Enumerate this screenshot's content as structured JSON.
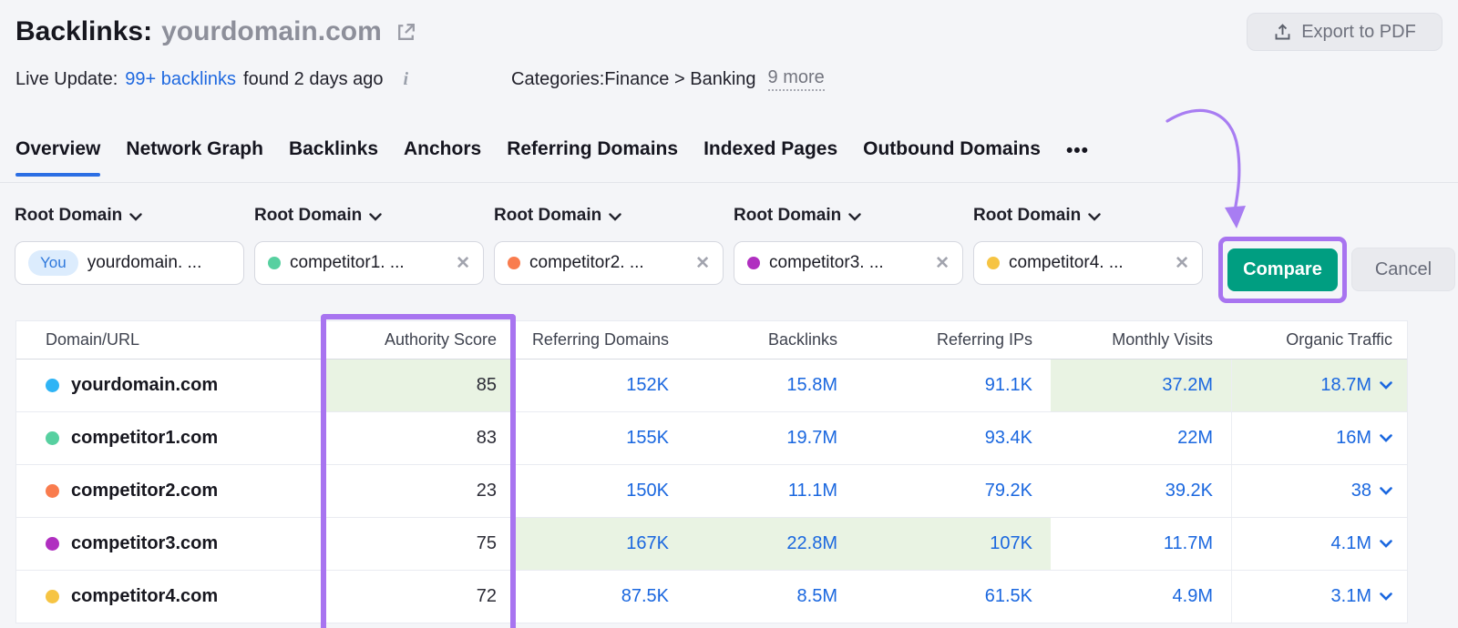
{
  "header": {
    "title": "Backlinks:",
    "domain": "yourdomain.com",
    "export_label": "Export to PDF"
  },
  "subheader": {
    "live_update_label": "Live Update:",
    "live_update_link": "99+ backlinks",
    "live_update_suffix": "found 2 days ago",
    "info_glyph": "i",
    "categories_label": "Categories:",
    "categories_value": "Finance > Banking",
    "categories_more": "9 more"
  },
  "tabs": {
    "items": [
      {
        "label": "Overview",
        "active": true
      },
      {
        "label": "Network Graph",
        "active": false
      },
      {
        "label": "Backlinks",
        "active": false
      },
      {
        "label": "Anchors",
        "active": false
      },
      {
        "label": "Referring Domains",
        "active": false
      },
      {
        "label": "Indexed Pages",
        "active": false
      },
      {
        "label": "Outbound Domains",
        "active": false
      }
    ],
    "more_glyph": "•••"
  },
  "filters": {
    "dropdown_label": "Root Domain",
    "you_badge": "You",
    "remove_glyph": "✕",
    "slots": [
      {
        "text": "yourdomain. ..."
      },
      {
        "text": "competitor1. ..."
      },
      {
        "text": "competitor2. ..."
      },
      {
        "text": "competitor3. ..."
      },
      {
        "text": "competitor4. ..."
      }
    ],
    "compare_label": "Compare",
    "cancel_label": "Cancel"
  },
  "table": {
    "columns": [
      "Domain/URL",
      "Authority Score",
      "Referring Domains",
      "Backlinks",
      "Referring IPs",
      "Monthly Visits",
      "Organic Traffic"
    ],
    "rows": [
      {
        "domain": "yourdomain.com",
        "authority_score": "85",
        "referring_domains": "152K",
        "backlinks": "15.8M",
        "referring_ips": "91.1K",
        "monthly_visits": "37.2M",
        "organic_traffic": "18.7M"
      },
      {
        "domain": "competitor1.com",
        "authority_score": "83",
        "referring_domains": "155K",
        "backlinks": "19.7M",
        "referring_ips": "93.4K",
        "monthly_visits": "22M",
        "organic_traffic": "16M"
      },
      {
        "domain": "competitor2.com",
        "authority_score": "23",
        "referring_domains": "150K",
        "backlinks": "11.1M",
        "referring_ips": "79.2K",
        "monthly_visits": "39.2K",
        "organic_traffic": "38"
      },
      {
        "domain": "competitor3.com",
        "authority_score": "75",
        "referring_domains": "167K",
        "backlinks": "22.8M",
        "referring_ips": "107K",
        "monthly_visits": "11.7M",
        "organic_traffic": "4.1M"
      },
      {
        "domain": "competitor4.com",
        "authority_score": "72",
        "referring_domains": "87.5K",
        "backlinks": "8.5M",
        "referring_ips": "61.5K",
        "monthly_visits": "4.9M",
        "organic_traffic": "3.1M"
      }
    ]
  },
  "colors": {
    "annotation_purple": "#a874f0",
    "compare_green": "#009e81",
    "link_blue": "#1a67df",
    "tab_active_blue": "#2b6ee4",
    "highlight_green_cell": "#e9f3e3",
    "dot_yourdomain": "#2fb4f5",
    "dot_competitor1": "#57d0a0",
    "dot_competitor2": "#f97c4e",
    "dot_competitor3": "#b02fc0",
    "dot_competitor4": "#f6c443"
  }
}
